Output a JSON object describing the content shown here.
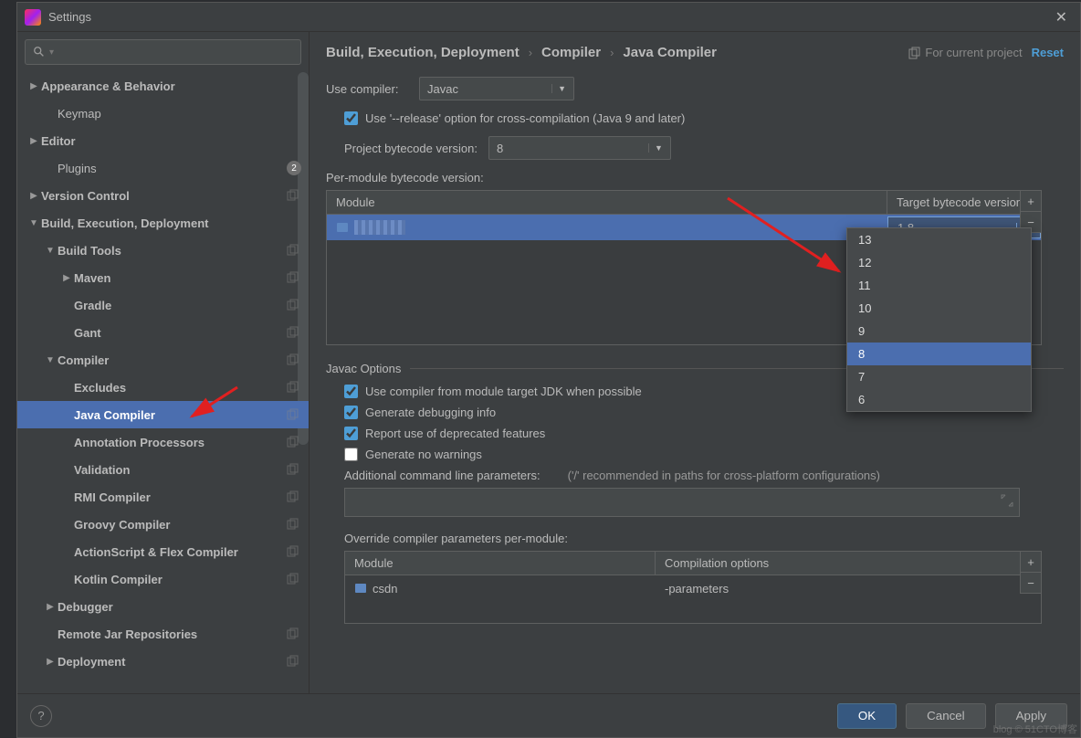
{
  "titlebar": {
    "title": "Settings"
  },
  "search": {
    "placeholder": ""
  },
  "sidebar": {
    "items": [
      {
        "label": "Appearance & Behavior",
        "arrow": "▶",
        "indent": 0,
        "bold": true
      },
      {
        "label": "Keymap",
        "indent": 1,
        "child": true
      },
      {
        "label": "Editor",
        "arrow": "▶",
        "indent": 0,
        "bold": true
      },
      {
        "label": "Plugins",
        "indent": 1,
        "child": true,
        "badge": "2"
      },
      {
        "label": "Version Control",
        "arrow": "▶",
        "indent": 0,
        "bold": true,
        "copy": true
      },
      {
        "label": "Build, Execution, Deployment",
        "arrow": "▼",
        "indent": 0,
        "bold": true
      },
      {
        "label": "Build Tools",
        "arrow": "▼",
        "indent": 1,
        "copy": true
      },
      {
        "label": "Maven",
        "arrow": "▶",
        "indent": 2,
        "copy": true
      },
      {
        "label": "Gradle",
        "indent": 2,
        "copy": true
      },
      {
        "label": "Gant",
        "indent": 2,
        "copy": true
      },
      {
        "label": "Compiler",
        "arrow": "▼",
        "indent": 1,
        "copy": true
      },
      {
        "label": "Excludes",
        "indent": 2,
        "copy": true
      },
      {
        "label": "Java Compiler",
        "indent": 2,
        "copy": true,
        "selected": true
      },
      {
        "label": "Annotation Processors",
        "indent": 2,
        "copy": true
      },
      {
        "label": "Validation",
        "indent": 2,
        "copy": true
      },
      {
        "label": "RMI Compiler",
        "indent": 2,
        "copy": true
      },
      {
        "label": "Groovy Compiler",
        "indent": 2,
        "copy": true
      },
      {
        "label": "ActionScript & Flex Compiler",
        "indent": 2,
        "copy": true
      },
      {
        "label": "Kotlin Compiler",
        "indent": 2,
        "copy": true
      },
      {
        "label": "Debugger",
        "arrow": "▶",
        "indent": 1
      },
      {
        "label": "Remote Jar Repositories",
        "indent": 1,
        "copy": true
      },
      {
        "label": "Deployment",
        "arrow": "▶",
        "indent": 1,
        "copy": true
      }
    ]
  },
  "breadcrumb": {
    "items": [
      "Build, Execution, Deployment",
      "Compiler",
      "Java Compiler"
    ],
    "for_project": "For current project",
    "reset": "Reset"
  },
  "compiler": {
    "use_compiler_label": "Use compiler:",
    "use_compiler_value": "Javac",
    "release_option": "Use '--release' option for cross-compilation (Java 9 and later)",
    "project_bytecode_label": "Project bytecode version:",
    "project_bytecode_value": "8",
    "per_module_label": "Per-module bytecode version:",
    "table": {
      "col_module": "Module",
      "col_target": "Target bytecode version",
      "row_target_value": "1.8"
    },
    "dropdown_options": [
      "13",
      "12",
      "11",
      "10",
      "9",
      "8",
      "7",
      "6"
    ],
    "dropdown_selected": "8"
  },
  "javac": {
    "title": "Javac Options",
    "opt1": "Use compiler from module target JDK when possible",
    "opt2": "Generate debugging info",
    "opt3": "Report use of deprecated features",
    "opt4": "Generate no warnings",
    "cmdline_label": "Additional command line parameters:",
    "cmdline_hint": "('/' recommended in paths for cross-platform configurations)",
    "override_label": "Override compiler parameters per-module:",
    "override_table": {
      "col_module": "Module",
      "col_opts": "Compilation options",
      "row_module": "csdn",
      "row_opts": "-parameters"
    }
  },
  "footer": {
    "ok": "OK",
    "cancel": "Cancel",
    "apply": "Apply"
  },
  "watermark": "blog © 51CTO博客"
}
